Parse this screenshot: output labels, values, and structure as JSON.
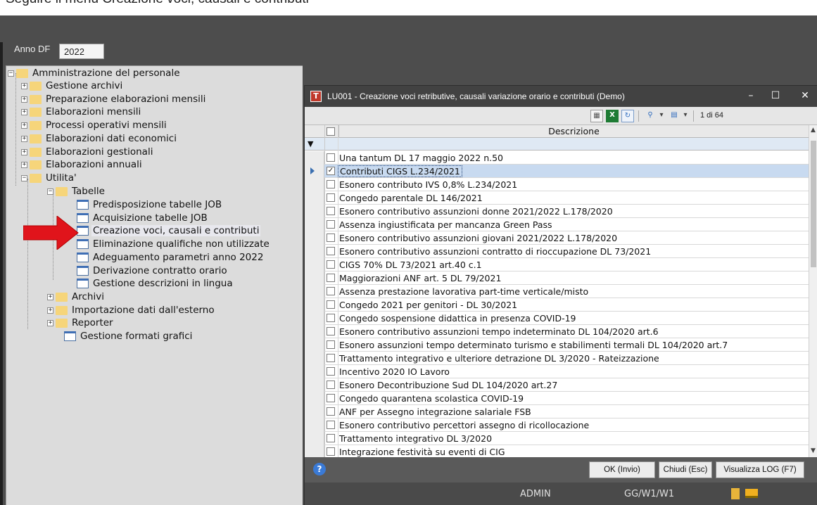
{
  "caption": "Seguire il menu Creazione voci, causali e contributi",
  "year_filter": {
    "label": "Anno DF",
    "value": "2022"
  },
  "tree": {
    "root": "Amministrazione del personale",
    "items": [
      {
        "label": "Gestione archivi"
      },
      {
        "label": "Preparazione elaborazioni mensili"
      },
      {
        "label": "Elaborazioni mensili"
      },
      {
        "label": "Processi operativi mensili"
      },
      {
        "label": "Elaborazioni dati economici"
      },
      {
        "label": "Elaborazioni gestionali"
      },
      {
        "label": "Elaborazioni annuali"
      },
      {
        "label": "Utilita'"
      }
    ],
    "tabelle": {
      "label": "Tabelle",
      "children": [
        {
          "label": "Predisposizione tabelle JOB"
        },
        {
          "label": "Acquisizione tabelle JOB"
        },
        {
          "label": "Creazione voci, causali e contributi"
        },
        {
          "label": "Eliminazione qualifiche non utilizzate"
        },
        {
          "label": "Adeguamento parametri anno 2022"
        },
        {
          "label": "Derivazione contratto orario"
        },
        {
          "label": "Gestione descrizioni in lingua"
        }
      ]
    },
    "utility_children": [
      {
        "label": "Archivi"
      },
      {
        "label": "Importazione dati dall'esterno"
      },
      {
        "label": "Reporter"
      },
      {
        "label": "Gestione formati grafici"
      }
    ]
  },
  "dialog": {
    "title": "LU001 - Creazione voci retributive, causali variazione orario e contributi  (Demo)",
    "app_icon": "T",
    "record_count": "1 di 64",
    "column_header": "Descrizione",
    "rows": [
      {
        "text": "Una tantum DL 17 maggio 2022  n.50",
        "checked": false
      },
      {
        "text": "Contributi CIGS L.234/2021",
        "checked": true,
        "current": true
      },
      {
        "text": "Esonero contributo IVS 0,8% L.234/2021",
        "checked": false
      },
      {
        "text": "Congedo parentale DL 146/2021",
        "checked": false
      },
      {
        "text": "Esonero contributivo assunzioni donne 2021/2022 L.178/2020",
        "checked": false
      },
      {
        "text": "Assenza ingiustificata per mancanza Green Pass",
        "checked": false
      },
      {
        "text": "Esonero contributivo assunzioni giovani 2021/2022 L.178/2020",
        "checked": false
      },
      {
        "text": "Esonero contributivo assunzioni contratto di rioccupazione DL 73/2021",
        "checked": false
      },
      {
        "text": "CIGS 70% DL 73/2021 art.40 c.1",
        "checked": false
      },
      {
        "text": "Maggiorazioni ANF art. 5 DL 79/2021",
        "checked": false
      },
      {
        "text": "Assenza prestazione lavorativa part-time verticale/misto",
        "checked": false
      },
      {
        "text": "Congedo 2021 per genitori - DL 30/2021",
        "checked": false
      },
      {
        "text": "Congedo sospensione didattica in presenza COVID-19",
        "checked": false
      },
      {
        "text": "Esonero contributivo assunzioni tempo indeterminato DL 104/2020 art.6",
        "checked": false
      },
      {
        "text": "Esonero assunzioni tempo determinato turismo e stabilimenti termali DL 104/2020 art.7",
        "checked": false
      },
      {
        "text": "Trattamento integrativo e ulteriore detrazione DL 3/2020 - Rateizzazione",
        "checked": false
      },
      {
        "text": "Incentivo 2020 IO Lavoro",
        "checked": false
      },
      {
        "text": "Esonero Decontribuzione Sud DL 104/2020 art.27",
        "checked": false
      },
      {
        "text": "Congedo quarantena scolastica COVID-19",
        "checked": false
      },
      {
        "text": "ANF per Assegno integrazione salariale FSB",
        "checked": false
      },
      {
        "text": "Esonero contributivo percettori assegno di ricollocazione",
        "checked": false
      },
      {
        "text": "Trattamento integrativo DL 3/2020",
        "checked": false
      },
      {
        "text": "Integrazione festività su eventi di CIG",
        "checked": false
      }
    ],
    "buttons": {
      "ok": "OK (Invio)",
      "close": "Chiudi (Esc)",
      "log": "Visualizza LOG (F7)"
    },
    "help_glyph": "?",
    "status": {
      "user": "ADMIN",
      "server": "GG/W1/W1"
    }
  },
  "colors": {
    "accent_arrow": "#e0141b",
    "title_bar": "#424242",
    "selected_row": "#c8daf0"
  }
}
